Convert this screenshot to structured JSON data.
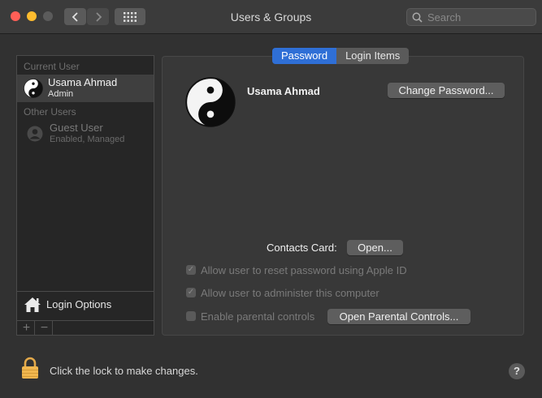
{
  "window": {
    "title": "Users & Groups",
    "search_placeholder": "Search"
  },
  "sidebar": {
    "current_user_header": "Current User",
    "current_user": {
      "name": "Usama Ahmad",
      "role": "Admin"
    },
    "other_users_header": "Other Users",
    "guest_user": {
      "name": "Guest User",
      "status": "Enabled, Managed"
    },
    "login_options": "Login Options",
    "add_label": "+",
    "remove_label": "−"
  },
  "tabs": [
    {
      "label": "Password",
      "active": true
    },
    {
      "label": "Login Items",
      "active": false
    }
  ],
  "detail": {
    "user_name": "Usama Ahmad",
    "change_password": "Change Password...",
    "contacts_card_label": "Contacts Card:",
    "open_button": "Open...",
    "options": [
      {
        "label": "Allow user to reset password using Apple ID",
        "checked": true
      },
      {
        "label": "Allow user to administer this computer",
        "checked": true
      },
      {
        "label": "Enable parental controls",
        "checked": false
      }
    ],
    "open_parental_controls": "Open Parental Controls..."
  },
  "footer": {
    "lock_text": "Click the lock to make changes.",
    "help_label": "?"
  },
  "colors": {
    "accent": "#2f6fd6",
    "traffic_red": "#fe5f57",
    "traffic_yellow": "#febc2e"
  }
}
